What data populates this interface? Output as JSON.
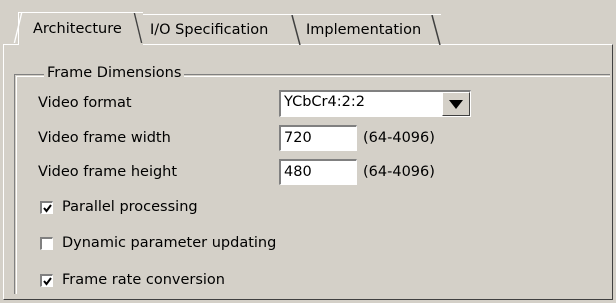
{
  "tabs": [
    {
      "label": "Architecture",
      "active": true
    },
    {
      "label": "I/O Specification",
      "active": false
    },
    {
      "label": "Implementation",
      "active": false
    }
  ],
  "group": {
    "title": "Frame Dimensions",
    "video_format": {
      "label": "Video format",
      "value": "YCbCr4:2:2"
    },
    "frame_width": {
      "label": "Video frame width",
      "value": "720",
      "range": "(64-4096)"
    },
    "frame_height": {
      "label": "Video frame height",
      "value": "480",
      "range": "(64-4096)"
    }
  },
  "options": [
    {
      "label": "Parallel processing",
      "checked": true
    },
    {
      "label": "Dynamic parameter updating",
      "checked": false
    },
    {
      "label": "Frame rate conversion",
      "checked": true
    }
  ]
}
